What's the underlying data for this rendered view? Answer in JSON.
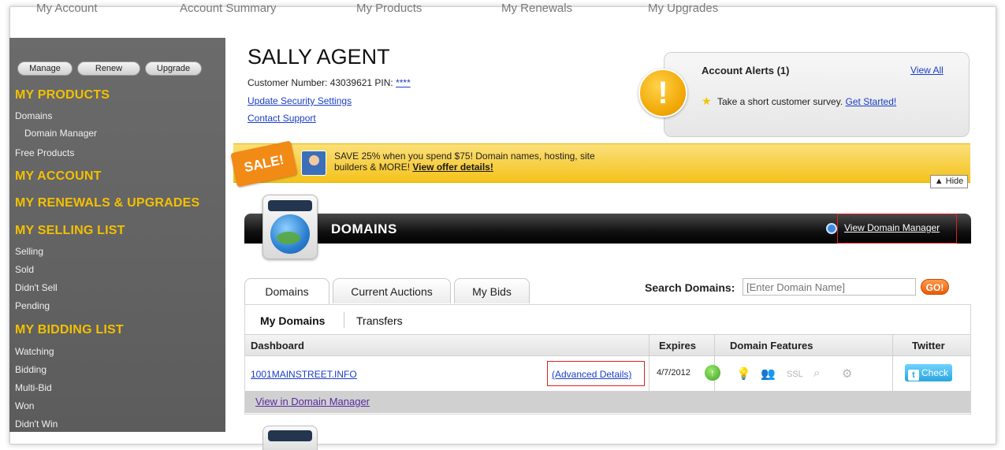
{
  "topnav": [
    "My Account",
    "Account Summary",
    "My Products",
    "My Renewals",
    "My Upgrades"
  ],
  "sidebar": {
    "buttons": [
      "Manage",
      "Renew",
      "Upgrade"
    ],
    "sections": {
      "products": "MY PRODUCTS",
      "account": "MY ACCOUNT",
      "renewals": "MY RENEWALS & UPGRADES",
      "selling": "MY SELLING LIST",
      "bidding": "MY BIDDING LIST"
    },
    "products_items": [
      "Domains",
      "Domain Manager",
      "Free Products"
    ],
    "selling_items": [
      "Selling",
      "Sold",
      "Didn't Sell",
      "Pending"
    ],
    "bidding_items": [
      "Watching",
      "Bidding",
      "Multi-Bid",
      "Won",
      "Didn't Win"
    ]
  },
  "customer": {
    "name": "SALLY AGENT",
    "number_label": "Customer Number: 43039621   PIN: ",
    "pin": "****",
    "security_link": "Update Security Settings",
    "support_link": "Contact Support"
  },
  "alerts": {
    "title": "Account Alerts (1)",
    "view_all": "View All",
    "message": "Take a short customer survey. ",
    "message_link": "Get Started!"
  },
  "sale": {
    "tag": "SALE!",
    "text": "SAVE 25% when you spend $75! Domain names, hosting, site builders & MORE! ",
    "offer_link": "View offer details!",
    "hide": "▲ Hide"
  },
  "domains": {
    "title": "DOMAINS",
    "view_manager": "View Domain Manager",
    "tabs": [
      "Domains",
      "Current Auctions",
      "My Bids"
    ],
    "search_label": "Search Domains:",
    "search_placeholder": "[Enter Domain Name]",
    "go": "GO!",
    "subtabs": [
      "My Domains",
      "Transfers"
    ],
    "columns": [
      "Dashboard",
      "Expires",
      "Domain Features",
      "Twitter"
    ],
    "rows": [
      {
        "domain": "1001MAINSTREET.INFO",
        "advanced": "(Advanced Details)",
        "expires": "4/7/2012",
        "twitter": "Check"
      }
    ],
    "view_in_manager": "View in Domain Manager"
  },
  "colors": {
    "sidebar_bg": "#5f5f5f",
    "section_yellow": "#f3c000",
    "link_blue": "#1a3ec8",
    "sale_yellow": "#f4c21b",
    "highlight_red": "#e02020"
  }
}
